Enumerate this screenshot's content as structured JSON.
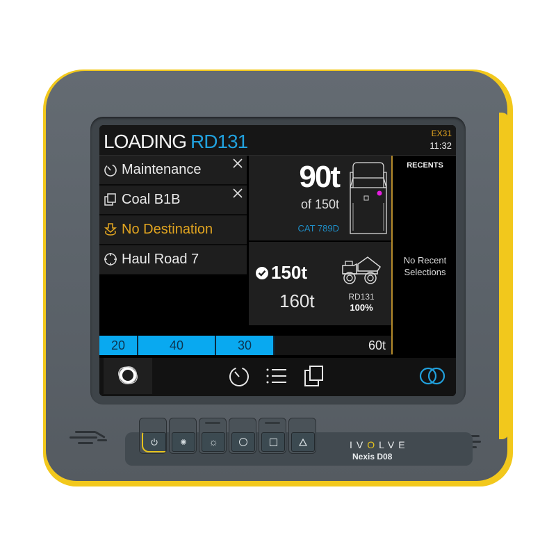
{
  "header": {
    "title": "LOADING",
    "title_accent": "RD131",
    "unit_id": "EX31",
    "time": "11:32"
  },
  "list": [
    {
      "icon": "timer-icon",
      "label": "Maintenance",
      "closable": true,
      "status": "normal"
    },
    {
      "icon": "copy-icon",
      "label": "Coal B1B",
      "closable": true,
      "status": "normal"
    },
    {
      "icon": "destination-icon",
      "label": "No Destination",
      "closable": false,
      "status": "warning"
    },
    {
      "icon": "crosshair-icon",
      "label": "Haul Road 7",
      "closable": false,
      "status": "normal"
    }
  ],
  "load": {
    "current": "90t",
    "capacity": "of 150t",
    "truck_model": "CAT 789D"
  },
  "target": {
    "target_load": "150t",
    "actual_load": "160t",
    "truck_id": "RD131",
    "truck_percent": "100%"
  },
  "recents": {
    "title": "RECENTS",
    "empty_message": "No Recent Selections"
  },
  "passes": {
    "segments": [
      20,
      40,
      30
    ],
    "remaining": "60t",
    "total": 150
  },
  "nav": {
    "items": [
      "home-icon",
      "timer-icon",
      "list-icon",
      "copy-icon",
      "link-icon"
    ]
  },
  "device": {
    "brand": "IVOLVE",
    "model": "Nexis D08",
    "hardware_buttons": [
      "power-icon",
      "brightness-low-icon",
      "brightness-high-icon",
      "circle-icon",
      "square-icon",
      "triangle-icon"
    ]
  },
  "colors": {
    "accent": "#21a0dc",
    "warning": "#e2a520",
    "progress": "#09a9f0",
    "bumper": "#f2c81c"
  }
}
